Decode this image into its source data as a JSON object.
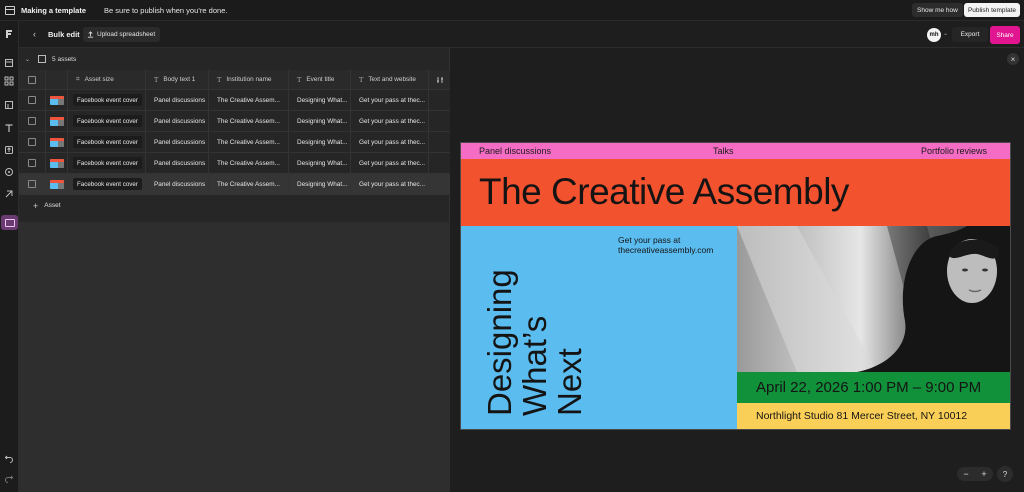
{
  "topbar": {
    "title": "Making a template",
    "message": "Be sure to publish when you’re done.",
    "show_me_label": "Show me how",
    "publish_label": "Publish template"
  },
  "subbar": {
    "back_icon": "chevron-left-icon",
    "title": "Bulk edit",
    "upload_label": "Upload spreadsheet",
    "avatar_initials": "mh",
    "export_label": "Export",
    "share_label": "Share",
    "share_color": "#e0158f"
  },
  "table": {
    "assets_count_label": "5 assets",
    "columns": [
      "Asset size",
      "Body text 1",
      "Institution name",
      "Event title",
      "Text and website"
    ],
    "rows": [
      {
        "size": "Facebook event cover",
        "body": "Panel discussions",
        "institution": "The Creative Assem...",
        "event": "Designing What...",
        "website": "Get your pass at thec..."
      },
      {
        "size": "Facebook event cover",
        "body": "Panel discussions",
        "institution": "The Creative Assem...",
        "event": "Designing What...",
        "website": "Get your pass at thec..."
      },
      {
        "size": "Facebook event cover",
        "body": "Panel discussions",
        "institution": "The Creative Assem...",
        "event": "Designing What...",
        "website": "Get your pass at thec..."
      },
      {
        "size": "Facebook event cover",
        "body": "Panel discussions",
        "institution": "The Creative Assem...",
        "event": "Designing What...",
        "website": "Get your pass at thec..."
      },
      {
        "size": "Facebook event cover",
        "body": "Panel discussions",
        "institution": "The Creative Assem...",
        "event": "Designing What...",
        "website": "Get your pass at thec..."
      }
    ],
    "add_label": "Asset"
  },
  "design": {
    "tag_1": "Panel discussions",
    "tag_2": "Talks",
    "tag_3": "Portfolio reviews",
    "headline": "The Creative Assembly",
    "pass_line_1": "Get your pass at",
    "pass_line_2": "thecreativeassembly.com",
    "event_line_1": "Designing",
    "event_line_2": "What’s",
    "event_line_3": "Next",
    "date_time": "April 22, 2026 1:00 PM – 9:00 PM",
    "location": "Northlight Studio 81 Mercer Street, NY 10012",
    "colors": {
      "pink": "#f46cc4",
      "red": "#f3522f",
      "blue": "#5bbcf0",
      "green": "#12913b",
      "yellow": "#f9cf57"
    }
  },
  "preview": {
    "zoom_out": "−",
    "zoom_in": "+",
    "help": "?",
    "close": "×"
  }
}
